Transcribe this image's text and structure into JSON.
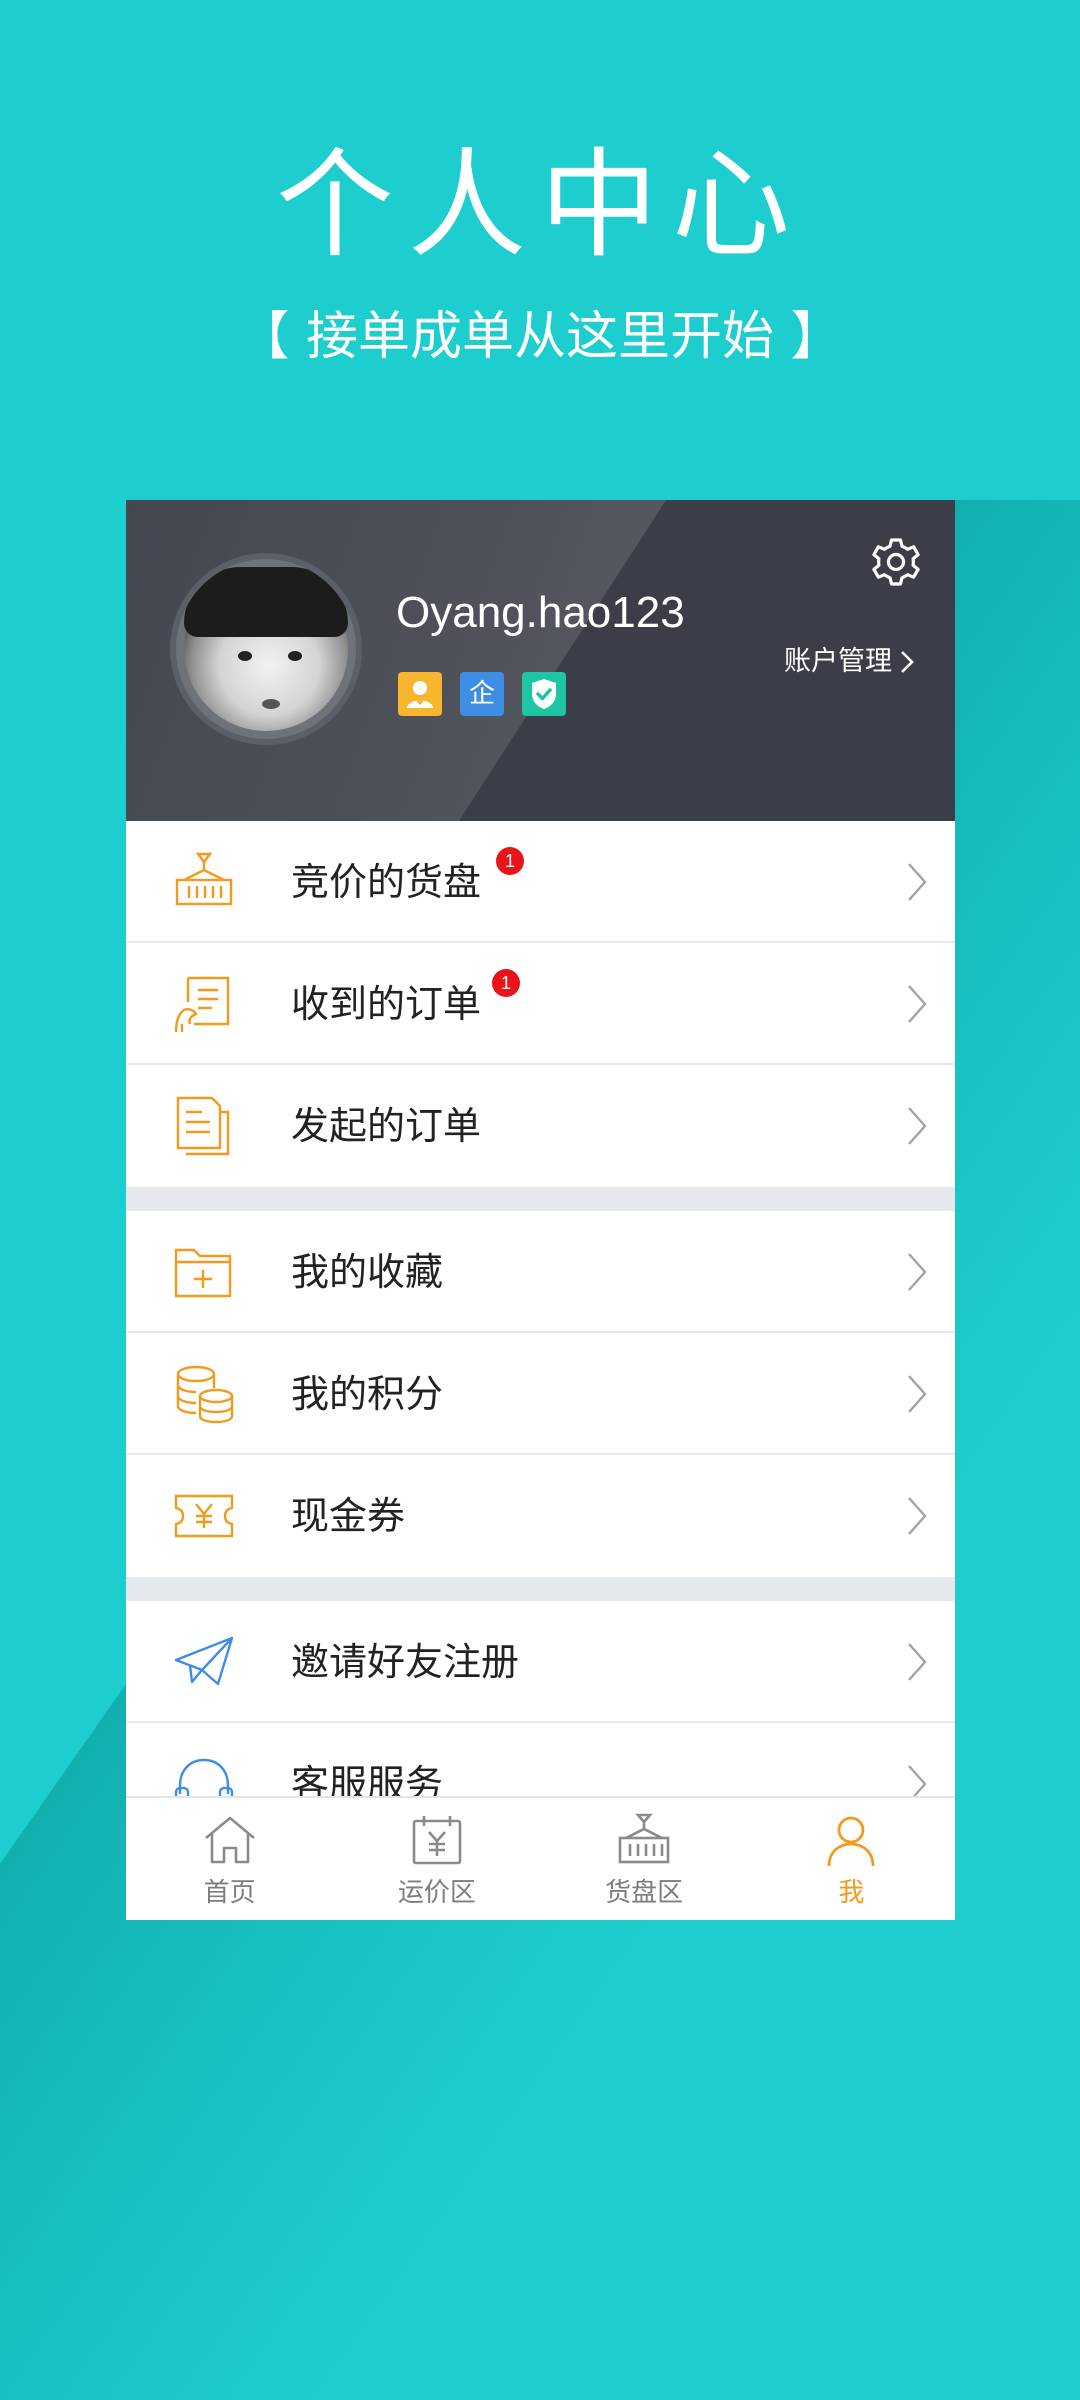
{
  "promo": {
    "title": "个人中心",
    "subtitle": "【 接单成单从这里开始 】"
  },
  "profile": {
    "username": "Oyang.hao123",
    "account_manage_label": "账户管理",
    "badges": [
      {
        "icon": "person-badge-icon",
        "glyph": "👤",
        "color": "#f8b52e"
      },
      {
        "icon": "enterprise-badge-icon",
        "glyph": "企",
        "color": "#3f8ee6"
      },
      {
        "icon": "verified-shield-icon",
        "glyph": "✓",
        "color": "#1ec6a4"
      }
    ]
  },
  "menu": {
    "groups": [
      [
        {
          "label": "竞价的货盘",
          "icon": "cargo-pallet-icon",
          "badge": "1"
        },
        {
          "label": "收到的订单",
          "icon": "received-order-icon",
          "badge": "1"
        },
        {
          "label": "发起的订单",
          "icon": "sent-order-icon"
        }
      ],
      [
        {
          "label": "我的收藏",
          "icon": "favorites-folder-icon"
        },
        {
          "label": "我的积分",
          "icon": "coins-icon"
        },
        {
          "label": "现金券",
          "icon": "cash-voucher-icon"
        }
      ],
      [
        {
          "label": "邀请好友注册",
          "icon": "paper-plane-icon"
        },
        {
          "label": "客服服务",
          "icon": "headset-icon"
        }
      ]
    ]
  },
  "tabbar": {
    "tabs": [
      {
        "label": "首页",
        "icon": "home-icon"
      },
      {
        "label": "运价区",
        "icon": "freight-price-icon"
      },
      {
        "label": "货盘区",
        "icon": "cargo-area-icon"
      },
      {
        "label": "我",
        "icon": "user-icon",
        "active": true
      }
    ]
  },
  "colors": {
    "background": "#1ecdcd",
    "header": "#3b3e48",
    "accent_orange": "#f39a1e",
    "accent_blue": "#3f8ee6",
    "badge_red": "#e8141a"
  }
}
